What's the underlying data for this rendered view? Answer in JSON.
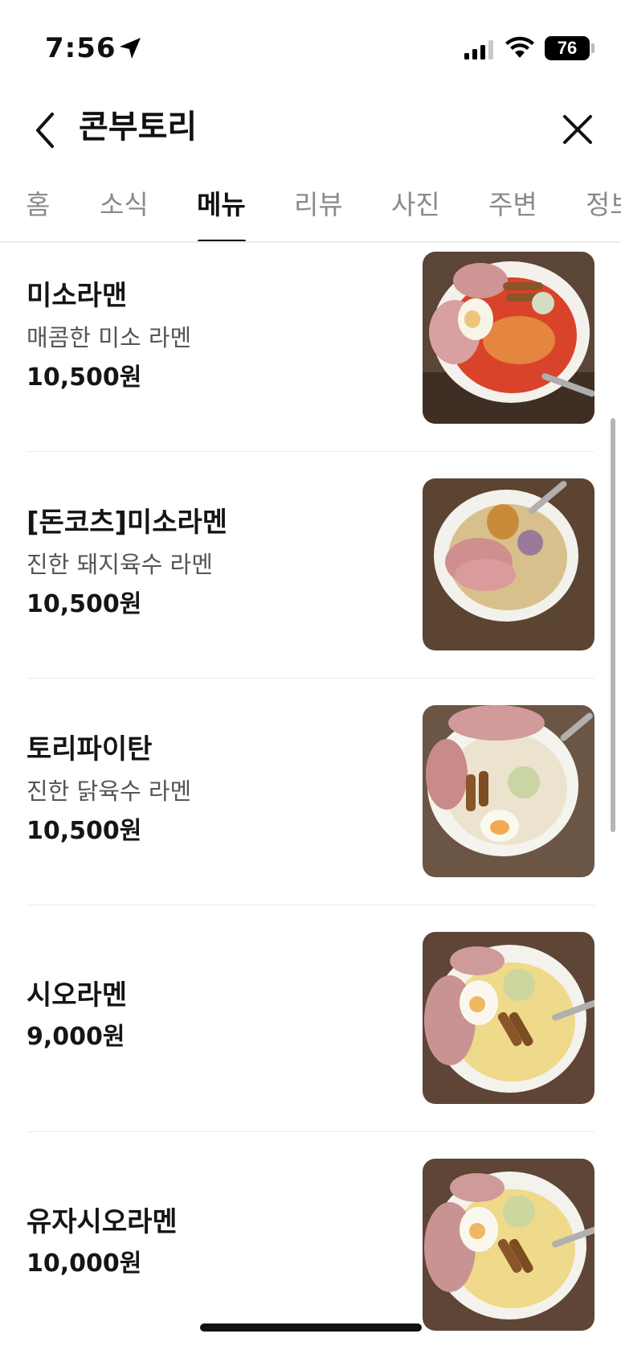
{
  "status_bar": {
    "time": "7:56",
    "battery": "76"
  },
  "header": {
    "title": "콘부토리"
  },
  "tabs": [
    {
      "label": "홈"
    },
    {
      "label": "소식"
    },
    {
      "label": "메뉴"
    },
    {
      "label": "리뷰"
    },
    {
      "label": "사진"
    },
    {
      "label": "주변"
    },
    {
      "label": "정보"
    }
  ],
  "active_tab": "메뉴",
  "menu": [
    {
      "name": "미소라맨",
      "description": "매콤한 미소 라멘",
      "price": "10,500원",
      "photo": "spicy-miso-ramen-photo"
    },
    {
      "name": "[돈코츠]미소라멘",
      "description": "진한 돼지육수 라멘",
      "price": "10,500원",
      "photo": "tonkotsu-miso-ramen-photo"
    },
    {
      "name": "토리파이탄",
      "description": "진한 닭육수 라멘",
      "price": "10,500원",
      "photo": "tori-paitan-photo"
    },
    {
      "name": "시오라멘",
      "price": "9,000원",
      "photo": "shio-ramen-photo"
    },
    {
      "name": "유자시오라멘",
      "price": "10,000원",
      "photo": "yuzu-shio-ramen-photo"
    }
  ],
  "colors": {
    "text_primary": "#111111",
    "text_secondary": "#555555",
    "tab_inactive": "#8a8a8a",
    "divider": "#ececec",
    "background": "#ffffff"
  },
  "icons": [
    "location-arrow-icon",
    "signal-icon",
    "wifi-icon",
    "battery-icon",
    "back-chevron-icon",
    "close-icon"
  ]
}
